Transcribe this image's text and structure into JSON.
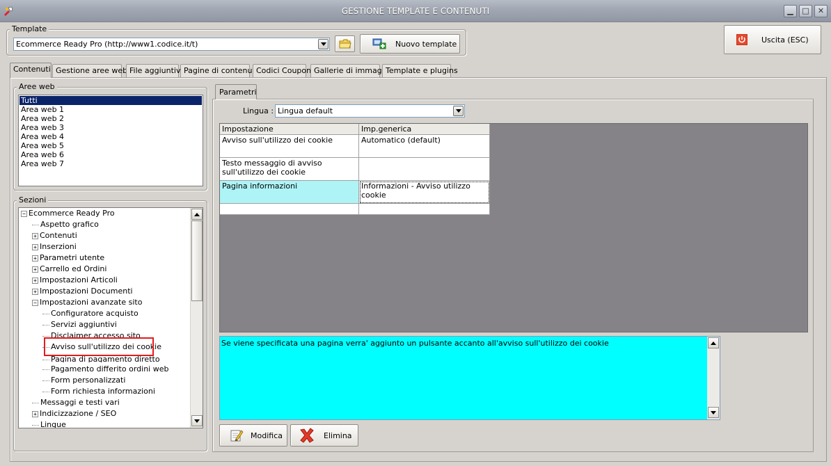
{
  "window": {
    "title": "GESTIONE TEMPLATE E CONTENUTI",
    "minimize": "▁",
    "maximize": "□",
    "close": "✕"
  },
  "template_group": {
    "label": "Template",
    "selected": "Ecommerce Ready Pro (http://www1.codice.it/t)",
    "new_button": "Nuovo template"
  },
  "exit_button": "Uscita (ESC)",
  "tabs": [
    {
      "label": "Contenuti"
    },
    {
      "label": "Gestione aree web"
    },
    {
      "label": "File aggiuntivi"
    },
    {
      "label": "Pagine di contenuti"
    },
    {
      "label": "Codici Coupon"
    },
    {
      "label": "Gallerie di immagini"
    },
    {
      "label": "Template e plugins"
    }
  ],
  "aree_web": {
    "label": "Aree web",
    "items": [
      "Tutti",
      "Area web 1",
      "Area web 2",
      "Area web 3",
      "Area web 4",
      "Area web 5",
      "Area web 6",
      "Area web 7"
    ]
  },
  "sezioni": {
    "label": "Sezioni",
    "tree": [
      {
        "label": "Ecommerce Ready Pro"
      },
      {
        "label": "Aspetto grafico"
      },
      {
        "label": "Contenuti"
      },
      {
        "label": "Inserzioni"
      },
      {
        "label": "Parametri utente"
      },
      {
        "label": "Carrello ed Ordini"
      },
      {
        "label": "Impostazioni Articoli"
      },
      {
        "label": "Impostazioni Documenti"
      },
      {
        "label": "Impostazioni avanzate sito"
      },
      {
        "label": "Configuratore acquisto"
      },
      {
        "label": "Servizi aggiuntivi"
      },
      {
        "label": "Disclaimer accesso sito"
      },
      {
        "label": "Avviso sull'utilizzo dei cookie"
      },
      {
        "label": "Pagina di pagamento diretto"
      },
      {
        "label": "Pagamento differito ordini web"
      },
      {
        "label": "Form personalizzati"
      },
      {
        "label": "Form richiesta informazioni"
      },
      {
        "label": "Messaggi e testi vari"
      },
      {
        "label": "Indicizzazione / SEO"
      },
      {
        "label": "Lingue"
      }
    ]
  },
  "parametri": {
    "tab_label": "Parametri",
    "lingua_label": "Lingua :",
    "lingua_value": "Lingua default",
    "grid": {
      "headers": [
        "Impostazione",
        "Imp.generica"
      ],
      "rows": [
        [
          "Avviso sull'utilizzo dei cookie",
          "Automatico (default)"
        ],
        [
          "Testo messaggio di avviso sull'utilizzo dei cookie",
          ""
        ],
        [
          "Pagina informazioni",
          "Informazioni - Avviso utilizzo cookie"
        ],
        [
          "",
          ""
        ]
      ]
    },
    "description": "Se viene specificata una pagina verra' aggiunto un pulsante accanto all'avviso sull'utilizzo dei cookie",
    "modifica_button": "Modifica",
    "elimina_button": "Elimina"
  },
  "colors": {
    "selected_row": "#aef4f7",
    "description_bg": "#00ffff",
    "highlight_border": "#e41b1b"
  }
}
